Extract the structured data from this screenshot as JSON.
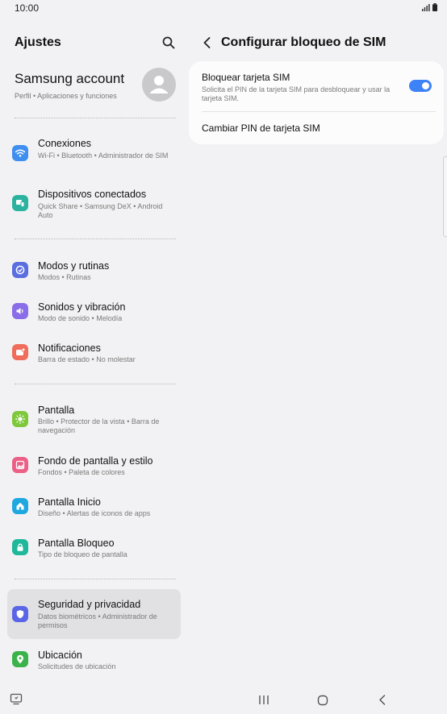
{
  "status_bar": {
    "time": "10:00"
  },
  "left_pane": {
    "title": "Ajustes",
    "account": {
      "title": "Samsung account",
      "subtitle": "Perfil  •  Aplicaciones y funciones"
    },
    "items": [
      {
        "title": "Conexiones",
        "subtitle": "Wi-Fi  •  Bluetooth  •  Administrador de SIM",
        "icon": "wifi-icon",
        "color": "#3f8ff0"
      },
      {
        "title": "Dispositivos conectados",
        "subtitle": "Quick Share  •  Samsung DeX  •  Android Auto",
        "icon": "connected-devices-icon",
        "color": "#2bb3a0"
      },
      {
        "title": "Modos y rutinas",
        "subtitle": "Modos  •  Rutinas",
        "icon": "modes-icon",
        "color": "#5b6ee0"
      },
      {
        "title": "Sonidos y vibración",
        "subtitle": "Modo de sonido  •  Melodía",
        "icon": "sound-icon",
        "color": "#8a6de8"
      },
      {
        "title": "Notificaciones",
        "subtitle": "Barra de estado  •  No molestar",
        "icon": "notifications-icon",
        "color": "#f06d5c"
      },
      {
        "title": "Pantalla",
        "subtitle": "Brillo  •  Protector de la vista  •  Barra de navegación",
        "icon": "display-icon",
        "color": "#7ec83c"
      },
      {
        "title": "Fondo de pantalla y estilo",
        "subtitle": "Fondos  •  Paleta de colores",
        "icon": "wallpaper-icon",
        "color": "#ec5f86"
      },
      {
        "title": "Pantalla Inicio",
        "subtitle": "Diseño  •  Alertas de iconos de apps",
        "icon": "home-screen-icon",
        "color": "#1fa7e0"
      },
      {
        "title": "Pantalla Bloqueo",
        "subtitle": "Tipo de bloqueo de pantalla",
        "icon": "lock-screen-icon",
        "color": "#1fb89a"
      },
      {
        "title": "Seguridad y privacidad",
        "subtitle": "Datos biométricos  •  Administrador de permisos",
        "icon": "security-icon",
        "color": "#5a66e6",
        "active": true
      },
      {
        "title": "Ubicación",
        "subtitle": "Solicitudes de ubicación",
        "icon": "location-icon",
        "color": "#3cb24a"
      }
    ]
  },
  "right_pane": {
    "title": "Configurar bloqueo de SIM",
    "lock_sim": {
      "title": "Bloquear tarjeta SIM",
      "subtitle": "Solicita el PIN de la tarjeta SIM para desbloquear y usar la tarjeta SIM.",
      "enabled": true
    },
    "change_pin": {
      "title": "Cambiar PIN de tarjeta SIM"
    }
  },
  "colors": {
    "accent": "#3e82f7",
    "background": "#f2f2f4",
    "card": "#fcfcfd",
    "active_item": "#e1e1e4"
  }
}
